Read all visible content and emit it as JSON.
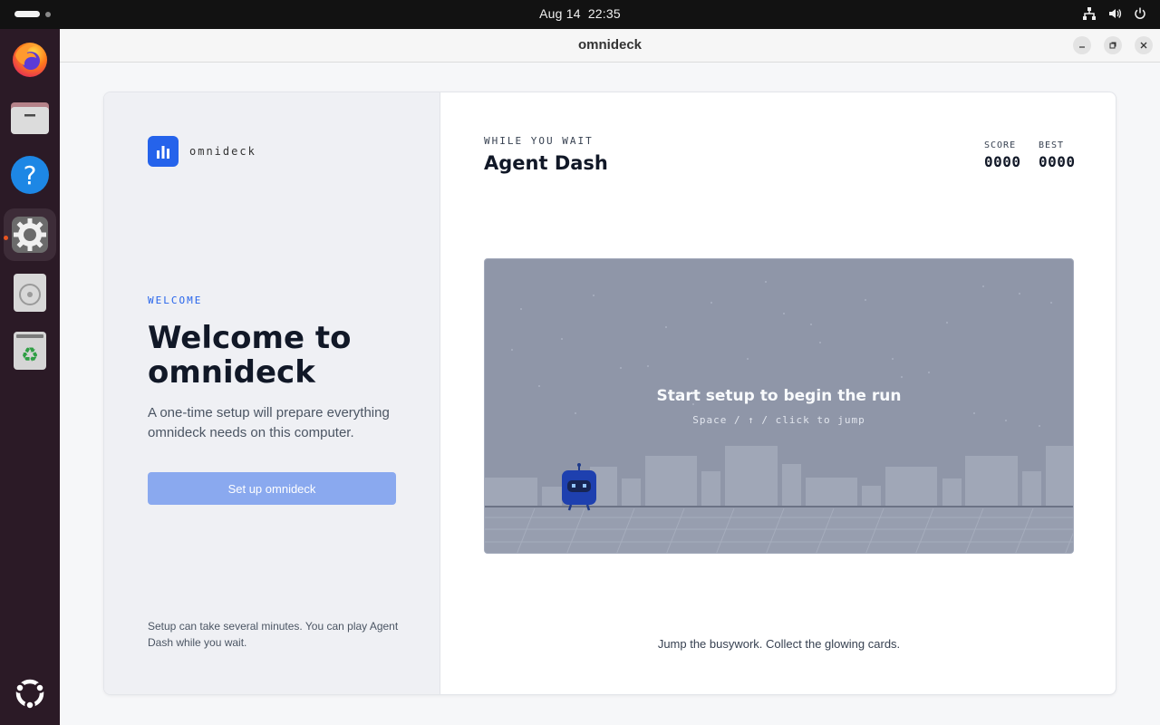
{
  "system": {
    "date": "Aug 14",
    "time": "22:35"
  },
  "dock": {
    "items": [
      {
        "name": "firefox-icon"
      },
      {
        "name": "files-icon"
      },
      {
        "name": "help-icon"
      },
      {
        "name": "settings-icon",
        "active": true
      },
      {
        "name": "disc-icon"
      },
      {
        "name": "trash-icon"
      },
      {
        "name": "ubuntu-apps-icon"
      }
    ]
  },
  "window": {
    "title": "omnideck"
  },
  "left": {
    "brand": "omnideck",
    "eyebrow": "WELCOME",
    "heading": "Welcome to omnideck",
    "description": "A one-time setup will prepare everything omnideck needs on this computer.",
    "button_label": "Set up omnideck",
    "footnote": "Setup can take several minutes. You can play Agent Dash while you wait."
  },
  "game": {
    "eyebrow": "WHILE YOU WAIT",
    "title": "Agent Dash",
    "score_label": "SCORE",
    "score_value": "0000",
    "best_label": "BEST",
    "best_value": "0000",
    "message": "Start setup to begin the run",
    "hint": "Space / ↑ / click to jump",
    "tagline": "Jump the busywork. Collect the glowing cards."
  },
  "colors": {
    "accent": "#2563eb",
    "button_disabled": "#8aa9ef",
    "game_bg": "#8f96a8",
    "dock_bg": "#2b1a26",
    "running_indicator": "#e95420"
  }
}
